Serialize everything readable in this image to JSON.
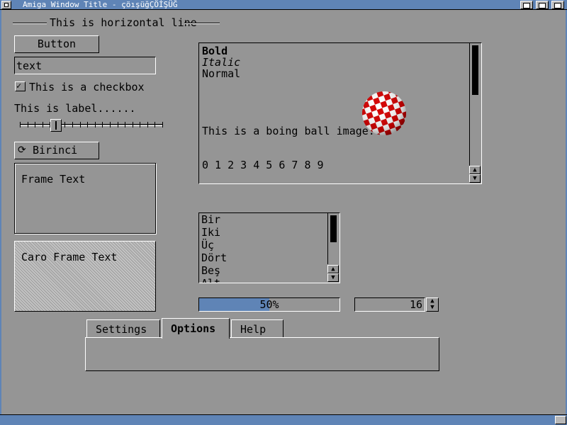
{
  "window": {
    "title": "Amiga Window Title - çöışüğÇÖİŞÜĞ",
    "accent_color": "#5f84b6"
  },
  "heading": {
    "text": "This is horizontal line"
  },
  "button": {
    "label": "Button"
  },
  "text_field": {
    "value": "text"
  },
  "checkbox": {
    "label": "This is a checkbox",
    "checked": true
  },
  "label": {
    "text": "This is label......"
  },
  "slider": {
    "value": 0.23,
    "ticks": 20
  },
  "cycle": {
    "selected": "Birinci",
    "icon": "cycle-icon"
  },
  "frame": {
    "title": "Frame Text"
  },
  "caro_frame": {
    "title": "Caro Frame Text"
  },
  "textarea": {
    "bold": "Bold",
    "italic": "Italic",
    "normal": "Normal",
    "image_caption": "This is a boing ball image:",
    "digits": "0 1 2 3 4 5 6 7 8 9",
    "scroll_up_icon": "arrow-up-icon",
    "scroll_down_icon": "arrow-down-icon"
  },
  "list": {
    "items": [
      "Bir",
      "Iki",
      "Üç",
      "Dört",
      "Beş",
      "Alt"
    ]
  },
  "progress": {
    "value": 0.5,
    "label": "50%"
  },
  "integer": {
    "value": "16"
  },
  "tabs": [
    {
      "label": "Settings",
      "active": false
    },
    {
      "label": "Options",
      "active": true
    },
    {
      "label": "Help",
      "active": false
    }
  ]
}
